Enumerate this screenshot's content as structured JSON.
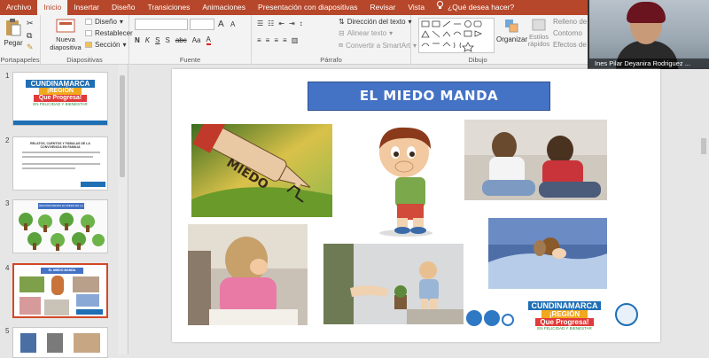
{
  "tabs": [
    "Archivo",
    "Inicio",
    "Insertar",
    "Diseño",
    "Transiciones",
    "Animaciones",
    "Presentación con diapositivas",
    "Revisar",
    "Vista"
  ],
  "active_tab": "Inicio",
  "tell_me": "¿Qué desea hacer?",
  "ribbon": {
    "portapapeles": {
      "label": "Portapapeles",
      "paste": "Pegar"
    },
    "diapositivas": {
      "label": "Diapositivas",
      "new_slide": "Nueva diapositiva",
      "layout": "Diseño",
      "reset": "Restablecer",
      "section": "Sección"
    },
    "fuente": {
      "label": "Fuente",
      "bold": "N",
      "italic": "K",
      "underline": "S",
      "strike": "S",
      "spacing": "abc",
      "size_up": "A",
      "size_down": "A",
      "case": "Aa",
      "color": "A"
    },
    "parrafo": {
      "label": "Párrafo",
      "text_direction": "Dirección del texto",
      "align_text": "Alinear texto",
      "smartart": "Convertir a SmartArt"
    },
    "dibujo": {
      "label": "Dibujo",
      "arrange": "Organizar",
      "quick_styles": "Estilos rápidos",
      "fill": "Relleno de",
      "outline": "Contorno",
      "effects": "Efectos de"
    }
  },
  "webcam": {
    "name": "Ines Pilar Deyanira Rodriguez ..."
  },
  "thumbnails": [
    {
      "num": "1",
      "line1": "CUNDINAMARCA",
      "line2": "¡REGIÓN",
      "line3": "Que Progresa!",
      "line4": "EN FELICIDAD Y BIENESTAR"
    },
    {
      "num": "2",
      "line1": "RELATOS, CUENTOS Y FÁBULAS DE LA CONVIVENCIA EN FAMILIA"
    },
    {
      "num": "3",
      "line1": "RECONOCIENDO EL MIEDO EN LA PRIMERA INFANCIA"
    },
    {
      "num": "4",
      "line1": "EL MIEDO MANDA"
    },
    {
      "num": "5"
    }
  ],
  "slide": {
    "title": "EL MIEDO MANDA",
    "arrow_text": "MIEDO",
    "logo": {
      "line1": "CUNDINAMARCA",
      "line2": "¡REGIÓN",
      "line3": "Que Progresa!",
      "line4": "EN FELICIDAD Y BIENESTAR"
    }
  },
  "colors": {
    "accent": "#b7472a",
    "title_fill": "#4472c4",
    "selected_border": "#d24726"
  }
}
